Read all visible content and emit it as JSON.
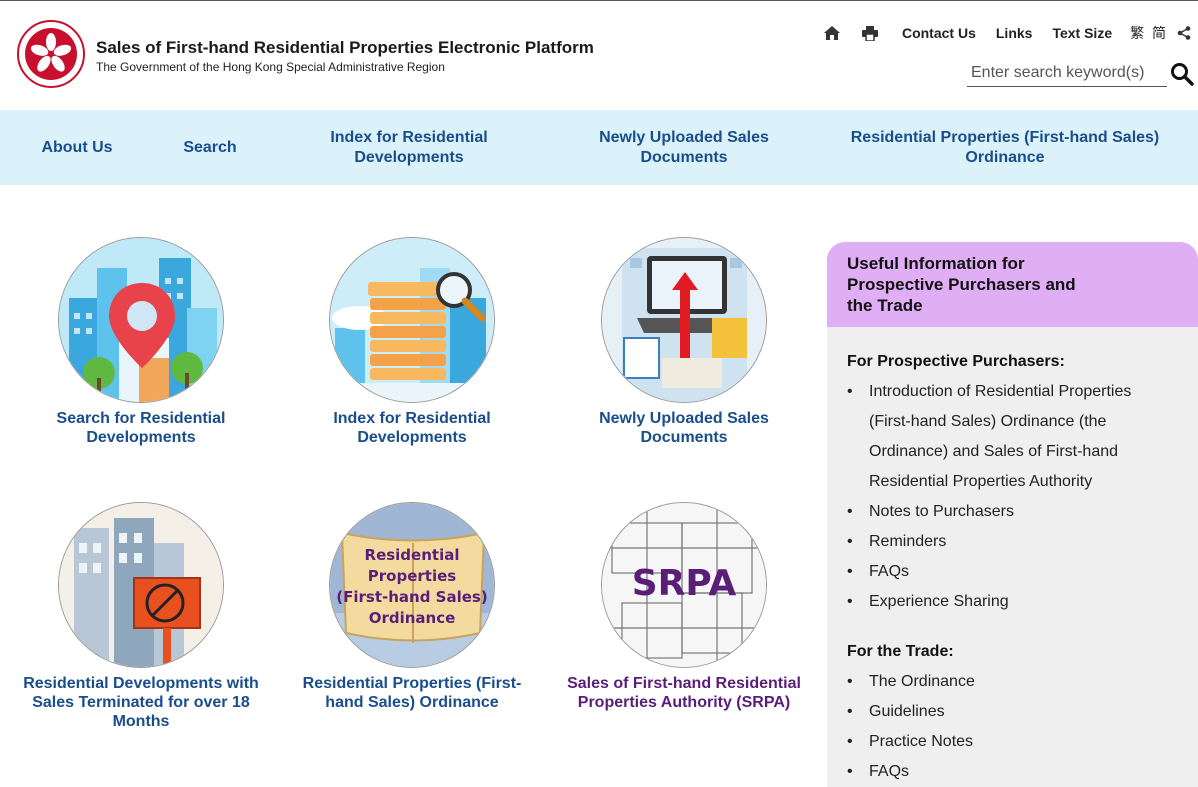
{
  "header": {
    "title": "Sales of First-hand Residential Properties Electronic Platform",
    "subtitle": "The Government of the Hong Kong Special Administrative Region"
  },
  "utility": {
    "home_icon": "home-icon",
    "print_icon": "print-icon",
    "contact_us": "Contact Us",
    "links": "Links",
    "text_size": "Text Size",
    "lang": "繁 简",
    "share_icon": "share-icon"
  },
  "search": {
    "placeholder": "Enter search keyword(s)"
  },
  "nav": {
    "items": [
      {
        "label": "About Us"
      },
      {
        "label": "Search"
      },
      {
        "label": "Index for Residential Developments"
      },
      {
        "label": "Newly Uploaded Sales Documents"
      },
      {
        "label": "Residential Properties (First-hand Sales) Ordinance"
      }
    ]
  },
  "tiles": [
    {
      "label": "Search for Residential Developments"
    },
    {
      "label": "Index for Residential Developments"
    },
    {
      "label": "Newly Uploaded Sales Documents"
    },
    {
      "label": "Residential Developments with Sales Terminated for over 18 Months"
    },
    {
      "label": "Residential Properties (First-hand Sales) Ordinance",
      "image_text": [
        "Residential",
        "Properties",
        "(First-hand Sales)",
        "Ordinance"
      ]
    },
    {
      "label": "Sales of First-hand Residential Properties Authority (SRPA)",
      "image_text": "SRPA"
    }
  ],
  "panel": {
    "title": "Useful Information for Prospective Purchasers and the Trade",
    "purchasers_heading": "For Prospective Purchasers:",
    "purchasers_items": [
      "Introduction of Residential Properties (First-hand Sales) Ordinance (the Ordinance) and Sales of First-hand Residential Properties Authority",
      "Notes to Purchasers",
      "Reminders",
      "FAQs",
      "Experience Sharing"
    ],
    "trade_heading": "For the Trade:",
    "trade_items": [
      "The Ordinance",
      "Guidelines",
      "Practice Notes",
      "FAQs"
    ]
  },
  "colors": {
    "nav_bg": "#dcf2fb",
    "link_blue": "#1a4d8c",
    "purple": "#5a1e78",
    "panel_header": "#e0aef4",
    "panel_bg": "#efefef"
  }
}
